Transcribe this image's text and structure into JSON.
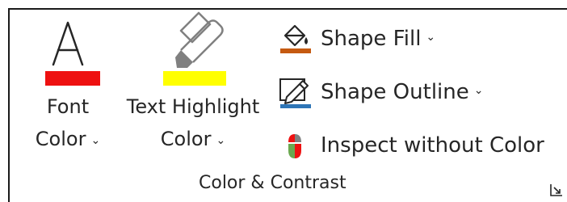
{
  "group": {
    "label": "Color & Contrast",
    "launcher_icon": "dialog-launcher-icon"
  },
  "font_color": {
    "label_line1": "Font",
    "label_line2": "Color",
    "icon": "font-color-a-icon",
    "swatch_color": "#ee1111",
    "chevron": "⌄"
  },
  "text_highlight": {
    "label_line1": "Text Highlight",
    "label_line2": "Color",
    "icon": "highlighter-pen-icon",
    "swatch_color": "#ffff00",
    "chevron": "⌄"
  },
  "shape_fill": {
    "label": "Shape Fill",
    "icon": "paint-bucket-icon",
    "swatch_color": "#c55a11",
    "chevron": "⌄"
  },
  "shape_outline": {
    "label": "Shape Outline",
    "icon": "pencil-outline-icon",
    "swatch_color": "#2e75b6",
    "chevron": "⌄"
  },
  "inspect": {
    "label": "Inspect without Color",
    "icon": "inspect-color-icon",
    "colors": [
      "#ee1111",
      "#6aa84f",
      "#808080"
    ]
  }
}
